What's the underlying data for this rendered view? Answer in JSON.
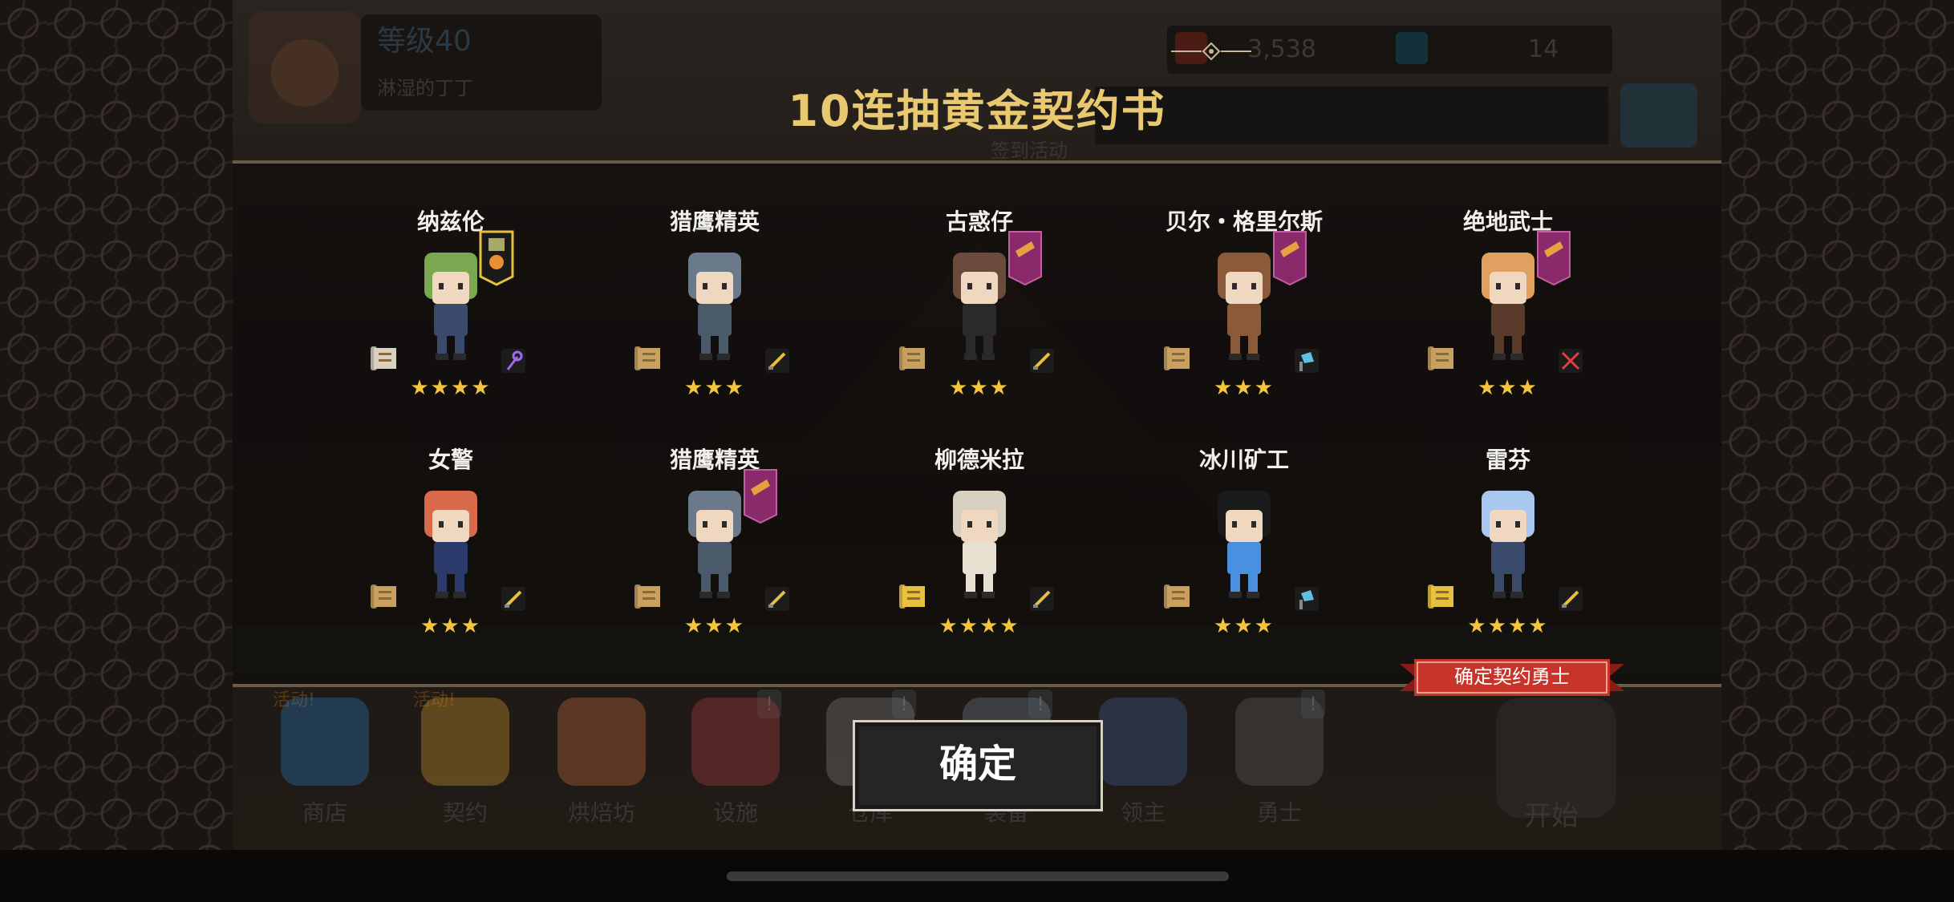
{
  "background": {
    "player": {
      "level_label": "等级40",
      "player_name": "淋湿的丁丁"
    },
    "resources": [
      {
        "value": "3,538",
        "icon": "star-coin-icon",
        "color": "#e24b2a"
      },
      {
        "value": "14",
        "icon": "gem-icon",
        "color": "#3aa0c8"
      }
    ],
    "sign_in_label": "签到活动",
    "bottom_nav": [
      {
        "label": "商店",
        "tag": "活动!",
        "icon": "shop-icon",
        "color": "#2a7ac0"
      },
      {
        "label": "契约",
        "tag": "活动!",
        "icon": "contract-icon",
        "color": "#d8a030"
      },
      {
        "label": "烘焙坊",
        "icon": "bakery-icon",
        "color": "#c87040"
      },
      {
        "label": "设施",
        "icon": "facility-icon",
        "color": "#b04040",
        "alert": "!"
      },
      {
        "label": "仓库",
        "icon": "warehouse-icon",
        "color": "#808080",
        "alert": "!"
      },
      {
        "label": "装备",
        "icon": "equipment-icon",
        "color": "#708090",
        "alert": "!"
      },
      {
        "label": "领主",
        "icon": "lord-icon",
        "color": "#4060a0"
      },
      {
        "label": "勇士",
        "icon": "warrior-icon",
        "color": "#606060",
        "alert": "!"
      }
    ],
    "start_label": "开始"
  },
  "dialog": {
    "title": "10连抽黄金契约书",
    "confirm_label": "确定",
    "contract_ribbon_label": "确定契约勇士",
    "heroes": [
      {
        "name": "纳兹伦",
        "stars": "★★★★",
        "banner": "gold-rank-banner-icon",
        "weapon": "staff-icon",
        "hair": "#7aa850",
        "outfit": "#3b4a6a",
        "scroll_color": "#d8d0c0",
        "weapon_color": "#9b6cf0"
      },
      {
        "name": "猎鹰精英",
        "stars": "★★★",
        "banner": "",
        "weapon": "sword-icon",
        "hair": "#6a7a8a",
        "outfit": "#4a5a6a",
        "scroll_color": "#c8a060",
        "weapon_color": "#e8c040"
      },
      {
        "name": "古惑仔",
        "stars": "★★★",
        "banner": "purple-rank-banner-icon",
        "weapon": "sword-icon",
        "hair": "#6a4a3a",
        "outfit": "#2a2a2a",
        "scroll_color": "#c8a060",
        "weapon_color": "#e8c040"
      },
      {
        "name": "贝尔・格里尔斯",
        "stars": "★★★",
        "banner": "purple-rank-banner-icon",
        "weapon": "axe-icon",
        "hair": "#8a5a3a",
        "outfit": "#8a5a3a",
        "scroll_color": "#c8a060",
        "weapon_color": "#60c0e0"
      },
      {
        "name": "绝地武士",
        "stars": "★★★",
        "banner": "purple-rank-banner-icon",
        "weapon": "crossed-swords-icon",
        "hair": "#e0a060",
        "outfit": "#5a3a2a",
        "scroll_color": "#c8a060",
        "weapon_color": "#e04040"
      },
      {
        "name": "女警",
        "stars": "★★★",
        "banner": "",
        "weapon": "sword-icon",
        "hair": "#d86a4a",
        "outfit": "#2a3a6a",
        "scroll_color": "#c8a060",
        "weapon_color": "#e8c040"
      },
      {
        "name": "猎鹰精英",
        "stars": "★★★",
        "banner": "purple-rank-banner-icon",
        "weapon": "sword-icon",
        "hair": "#6a7a8a",
        "outfit": "#4a5a6a",
        "scroll_color": "#c8a060",
        "weapon_color": "#e8c040"
      },
      {
        "name": "柳德米拉",
        "stars": "★★★★",
        "banner": "",
        "weapon": "sword-icon",
        "hair": "#d8d0c0",
        "outfit": "#e8e0d0",
        "scroll_color": "#e8c040",
        "weapon_color": "#e8c040"
      },
      {
        "name": "冰川矿工",
        "stars": "★★★",
        "banner": "",
        "weapon": "axe-icon",
        "hair": "#1a1a1a",
        "outfit": "#4a90e0",
        "scroll_color": "#c8a060",
        "weapon_color": "#60c0e0"
      },
      {
        "name": "雷芬",
        "stars": "★★★★",
        "banner": "",
        "weapon": "sword-icon",
        "hair": "#a8c8f0",
        "outfit": "#3a4a6a",
        "scroll_color": "#e8c040",
        "weapon_color": "#e8c040"
      }
    ]
  }
}
